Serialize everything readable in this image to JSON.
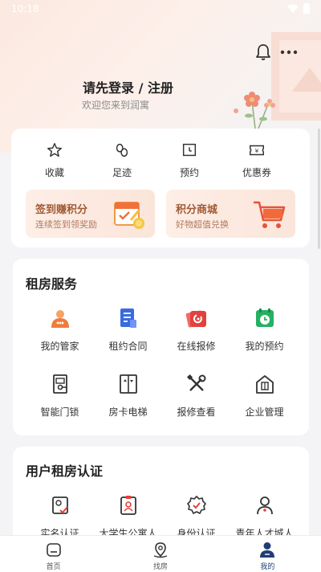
{
  "status": {
    "time": "10:18"
  },
  "header": {
    "login_title": "请先登录 / 注册",
    "login_subtitle": "欢迎您来到润寓"
  },
  "quick": [
    {
      "label": "收藏",
      "icon": "star-icon"
    },
    {
      "label": "足迹",
      "icon": "footprint-icon"
    },
    {
      "label": "预约",
      "icon": "calendar-icon"
    },
    {
      "label": "优惠券",
      "icon": "coupon-icon"
    }
  ],
  "promos": [
    {
      "title": "签到赚积分",
      "subtitle": "连续签到领奖励",
      "icon": "calendar-coin-icon"
    },
    {
      "title": "积分商城",
      "subtitle": "好物超值兑换",
      "icon": "shopping-cart-icon"
    }
  ],
  "rental": {
    "title": "租房服务",
    "items": [
      {
        "label": "我的管家",
        "icon": "butler-icon",
        "color": "#f07b3a"
      },
      {
        "label": "租约合同",
        "icon": "contract-icon",
        "color": "#3b6be0"
      },
      {
        "label": "在线报修",
        "icon": "repair-card-icon",
        "color": "#e2423d"
      },
      {
        "label": "我的预约",
        "icon": "clock-calendar-icon",
        "color": "#25b063"
      },
      {
        "label": "智能门锁",
        "icon": "door-lock-icon",
        "color": "#333333"
      },
      {
        "label": "房卡电梯",
        "icon": "elevator-icon",
        "color": "#333333"
      },
      {
        "label": "报修查看",
        "icon": "tools-icon",
        "color": "#333333"
      },
      {
        "label": "企业管理",
        "icon": "enterprise-icon",
        "color": "#333333"
      }
    ]
  },
  "cert": {
    "title": "用户租房认证",
    "items": [
      {
        "label": "实名认证",
        "icon": "id-check-icon"
      },
      {
        "label": "大学生公寓人",
        "icon": "student-badge-icon"
      },
      {
        "label": "身份认证",
        "icon": "verified-badge-icon"
      },
      {
        "label": "青年人才城人",
        "icon": "person-icon"
      }
    ]
  },
  "tabs": [
    {
      "label": "首页",
      "icon": "home-icon"
    },
    {
      "label": "找房",
      "icon": "location-icon"
    },
    {
      "label": "我的",
      "icon": "user-icon",
      "active": true
    }
  ],
  "colors": {
    "accent": "#1f3f73",
    "promo_text": "#a25a35"
  }
}
